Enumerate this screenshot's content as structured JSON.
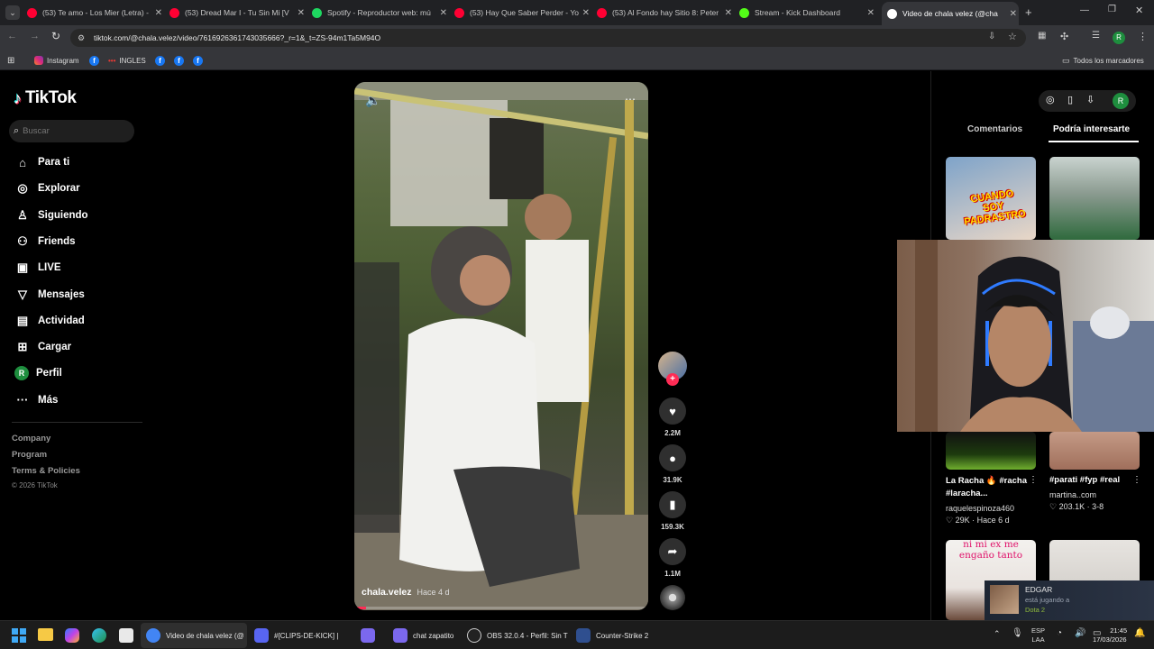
{
  "browser": {
    "tabs": [
      {
        "title": "(53) Te amo - Los Mier (Letra) -",
        "color": "#ff0033"
      },
      {
        "title": "(53) Dread Mar I - Tu Sin Mi [V",
        "color": "#ff0033"
      },
      {
        "title": "Spotify - Reproductor web: mú",
        "color": "#1ed760"
      },
      {
        "title": "(53) Hay Que Saber Perder - Yo",
        "color": "#ff0033"
      },
      {
        "title": "(53) Al Fondo hay Sitio 8: Peter",
        "color": "#ff0033"
      },
      {
        "title": "Stream - Kick Dashboard",
        "color": "#53fc18"
      },
      {
        "title": "Video de chala velez (@cha",
        "color": "#ffffff"
      }
    ],
    "url": "tiktok.com/@chala.velez/video/7616926361743035666?_r=1&_t=ZS-94m1Ta5M94O",
    "bookmarks": [
      "Instagram",
      "INGLES"
    ],
    "all_bookmarks": "Todos los marcadores",
    "profile_initial": "R"
  },
  "tiktok": {
    "logo": "TikTok",
    "search_placeholder": "Buscar",
    "nav": [
      {
        "label": "Para ti",
        "icon": "home-icon",
        "glyph": "⌂"
      },
      {
        "label": "Explorar",
        "icon": "compass-icon",
        "glyph": "◎"
      },
      {
        "label": "Siguiendo",
        "icon": "following-icon",
        "glyph": "♙"
      },
      {
        "label": "Friends",
        "icon": "friends-icon",
        "glyph": "⚇"
      },
      {
        "label": "LIVE",
        "icon": "live-icon",
        "glyph": "▣"
      },
      {
        "label": "Mensajes",
        "icon": "messages-icon",
        "glyph": "▽"
      },
      {
        "label": "Actividad",
        "icon": "activity-icon",
        "glyph": "▤"
      },
      {
        "label": "Cargar",
        "icon": "upload-icon",
        "glyph": "⊞"
      },
      {
        "label": "Perfil",
        "icon": "profile-icon",
        "glyph": "R"
      },
      {
        "label": "Más",
        "icon": "more-icon",
        "glyph": "···"
      }
    ],
    "footer": [
      "Company",
      "Program",
      "Terms & Policies"
    ],
    "copyright": "© 2026 TikTok",
    "video": {
      "author": "chala.velez",
      "age": "Hace 4 d",
      "likes": "2.2M",
      "comments": "31.9K",
      "saves": "159.3K",
      "shares": "1.1M"
    },
    "right_tabs": [
      "Comentarios",
      "Podría interesarte"
    ],
    "suggestions": [
      {
        "overlay": "CUANDO SOY PADRASTRO"
      },
      {
        "overlay": ""
      },
      {
        "title": "La Racha 🔥 #racha #laracha...",
        "author": "raquelespinoza460",
        "stats": "♡ 29K · Hace 6 d"
      },
      {
        "title": "#parati #fyp #real",
        "author": "martina..com",
        "stats": "♡ 203.1K · 3-8"
      },
      {
        "overlay": "ni mi ex me engaño tanto"
      },
      {
        "overlay": ""
      }
    ],
    "notification": {
      "name": "EDGAR",
      "line1": "está jugando a",
      "line2": "Dota 2"
    }
  },
  "taskbar": {
    "items": [
      "Video de chala velez (@",
      "#[CLIPS-DE-KICK] |",
      "",
      "chat zapatito",
      "OBS 32.0.4 - Perfil: Sin T",
      "Counter-Strike 2"
    ],
    "lang": "ESP",
    "region": "LAA",
    "time": "21:45",
    "date": "17/03/2026"
  }
}
